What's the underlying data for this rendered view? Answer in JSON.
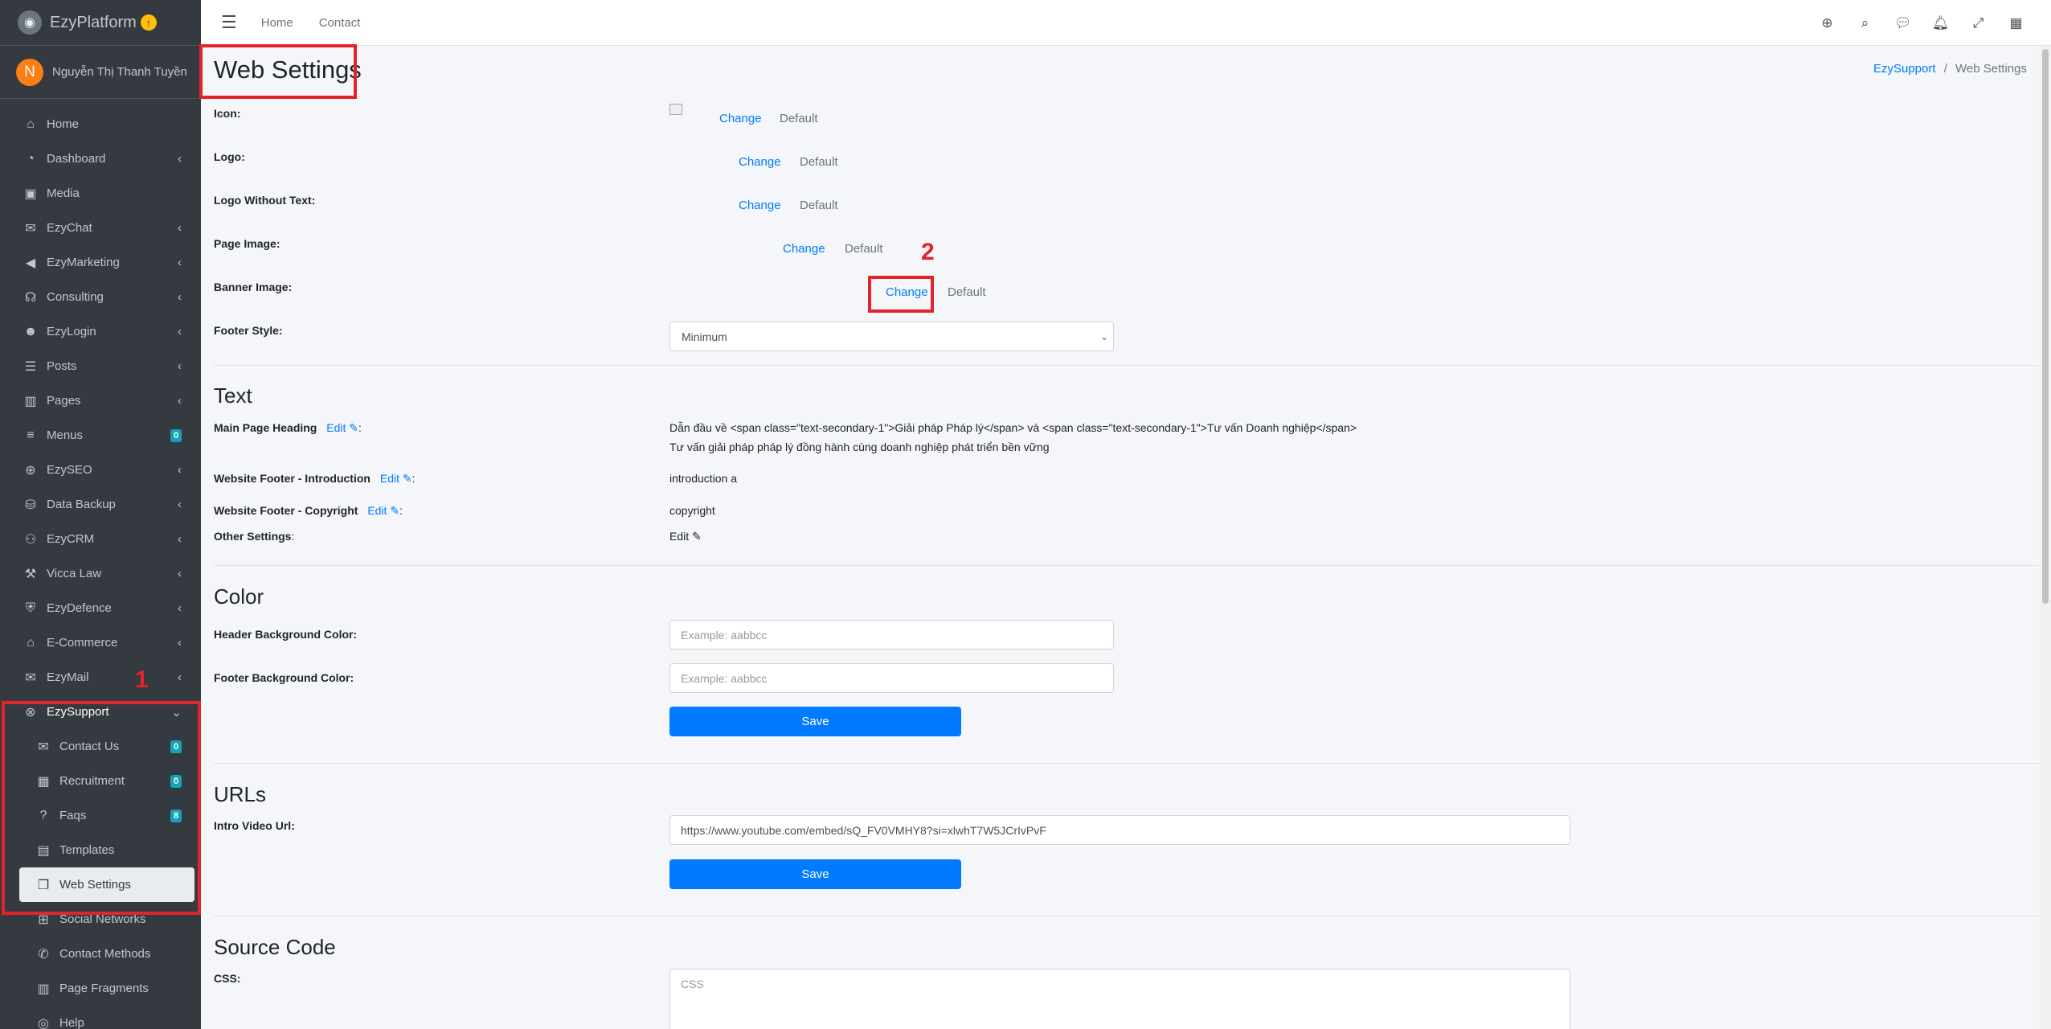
{
  "brand": {
    "name": "EzyPlatform"
  },
  "user": {
    "initial": "N",
    "name": "Nguyễn Thị Thanh Tuyền"
  },
  "sidebar": {
    "items": [
      {
        "label": "Home",
        "icon": "home-icon",
        "glyph": "⌂",
        "chevron": false
      },
      {
        "label": "Dashboard",
        "icon": "dashboard-icon",
        "glyph": "◔",
        "chevron": true
      },
      {
        "label": "Media",
        "icon": "image-icon",
        "glyph": "▣",
        "chevron": false
      },
      {
        "label": "EzyChat",
        "icon": "comments-icon",
        "glyph": "✉",
        "chevron": true
      },
      {
        "label": "EzyMarketing",
        "icon": "bullhorn-icon",
        "glyph": "◀",
        "chevron": true
      },
      {
        "label": "Consulting",
        "icon": "headset-icon",
        "glyph": "☊",
        "chevron": true
      },
      {
        "label": "EzyLogin",
        "icon": "user-lock-icon",
        "glyph": "☻",
        "chevron": true
      },
      {
        "label": "Posts",
        "icon": "list-alt-icon",
        "glyph": "☰",
        "chevron": true
      },
      {
        "label": "Pages",
        "icon": "book-icon",
        "glyph": "▥",
        "chevron": true
      },
      {
        "label": "Menus",
        "icon": "bars-icon",
        "glyph": "≡",
        "chevron": false,
        "badge": "0"
      },
      {
        "label": "EzySEO",
        "icon": "search-plus-icon",
        "glyph": "⊕",
        "chevron": true
      },
      {
        "label": "Data Backup",
        "icon": "database-icon",
        "glyph": "⛁",
        "chevron": true
      },
      {
        "label": "EzyCRM",
        "icon": "handshake-icon",
        "glyph": "⚇",
        "chevron": true
      },
      {
        "label": "Vicca Law",
        "icon": "gavel-icon",
        "glyph": "⚒",
        "chevron": true
      },
      {
        "label": "EzyDefence",
        "icon": "shield-icon",
        "glyph": "⛨",
        "chevron": true
      },
      {
        "label": "E-Commerce",
        "icon": "store-icon",
        "glyph": "⌂",
        "chevron": true
      },
      {
        "label": "EzyMail",
        "icon": "envelope-icon",
        "glyph": "✉",
        "chevron": true
      },
      {
        "label": "EzySupport",
        "icon": "life-ring-icon",
        "glyph": "⊗",
        "chevron": "down"
      }
    ],
    "subitems": [
      {
        "label": "Contact Us",
        "icon": "mail-bulk-icon",
        "glyph": "✉",
        "badge": "0"
      },
      {
        "label": "Recruitment",
        "icon": "th-large-icon",
        "glyph": "▦",
        "badge": "0"
      },
      {
        "label": "Faqs",
        "icon": "question-circle-icon",
        "glyph": "?",
        "badge": "8"
      },
      {
        "label": "Templates",
        "icon": "table-icon",
        "glyph": "▤"
      },
      {
        "label": "Web Settings",
        "icon": "window-restore-icon",
        "glyph": "❐",
        "active": true
      },
      {
        "label": "Social Networks",
        "icon": "share-square-icon",
        "glyph": "⊞"
      },
      {
        "label": "Contact Methods",
        "icon": "phone-icon",
        "glyph": "✆"
      },
      {
        "label": "Page Fragments",
        "icon": "book-open-icon",
        "glyph": "▥"
      },
      {
        "label": "Help",
        "icon": "help-icon",
        "glyph": "◎"
      }
    ]
  },
  "annotations": {
    "n1": "1",
    "n2": "2",
    "color": "#e3242b"
  },
  "topbar": {
    "home": "Home",
    "contact": "Contact"
  },
  "page": {
    "title": "Web Settings",
    "breadcrumb_link": "EzySupport",
    "breadcrumb_sep": "/",
    "breadcrumb_current": "Web Settings"
  },
  "images": {
    "icon_label": "Icon:",
    "logo_label": "Logo:",
    "logo_nt_label": "Logo Without Text:",
    "page_image_label": "Page Image:",
    "banner_label": "Banner Image:",
    "footer_style_label": "Footer Style:",
    "change": "Change",
    "default": "Default",
    "footer_style_value": "Minimum"
  },
  "text": {
    "section": "Text",
    "main_heading_label": "Main Page Heading",
    "edit": "Edit",
    "colon": ":",
    "main_heading_value1": "Dẫn đầu về <span class=\"text-secondary-1\">Giải pháp Pháp lý</span> và <span class=\"text-secondary-1\">Tư vấn Doanh nghiệp</span>",
    "main_heading_value2": "Tư vấn giải pháp pháp lý đồng hành cùng doanh nghiệp phát triển bền vững",
    "footer_intro_label": "Website Footer - Introduction",
    "footer_intro_value": "introduction a",
    "footer_copy_label": "Website Footer - Copyright",
    "footer_copy_value": "copyright",
    "other_label": "Other Settings"
  },
  "color": {
    "section": "Color",
    "header_label": "Header Background Color:",
    "footer_label": "Footer Background Color:",
    "placeholder": "Example: aabbcc",
    "save": "Save"
  },
  "urls": {
    "section": "URLs",
    "intro_label": "Intro Video Url:",
    "intro_value": "https://www.youtube.com/embed/sQ_FV0VMHY8?si=xlwhT7W5JCrIvPvF",
    "save": "Save"
  },
  "source": {
    "section": "Source Code",
    "css_label": "CSS:",
    "css_placeholder": "CSS"
  }
}
